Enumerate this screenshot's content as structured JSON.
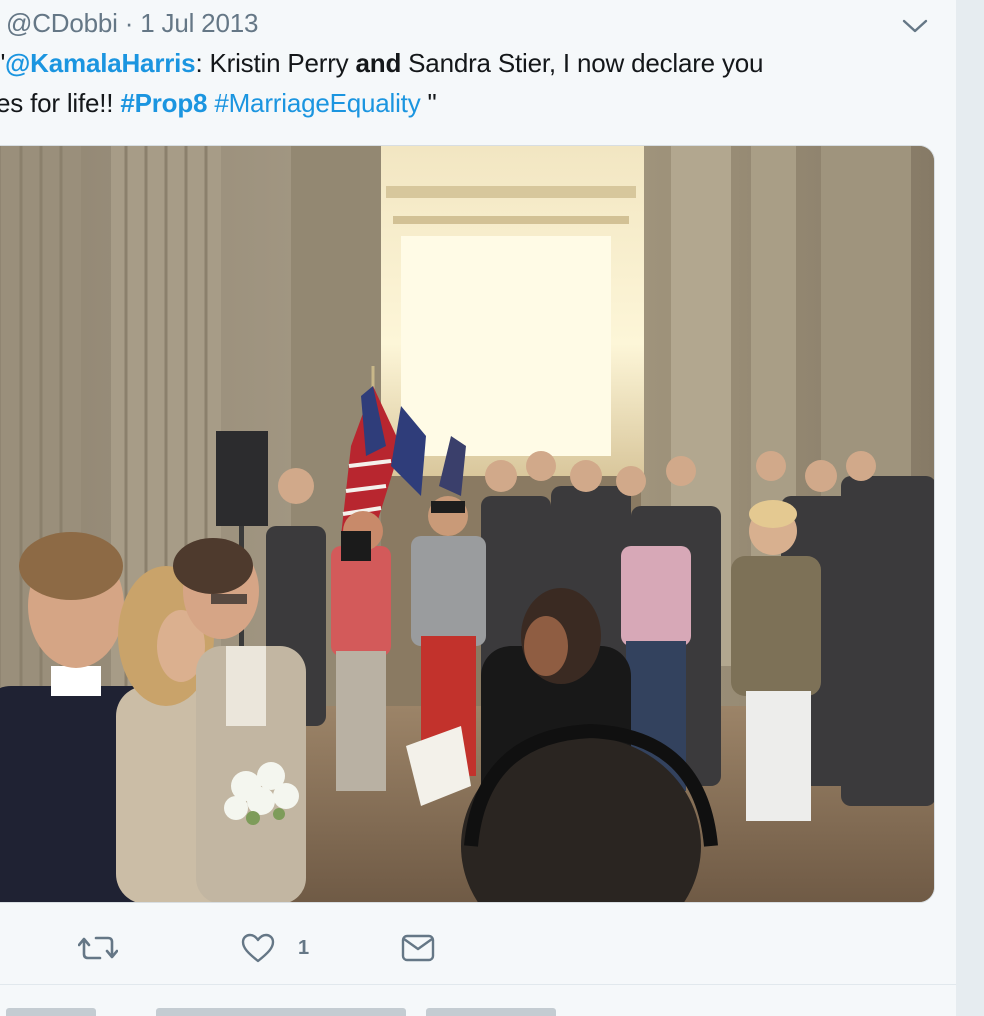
{
  "tweet": {
    "handle": "@CDobbi",
    "separator": "·",
    "date": "1 Jul 2013",
    "text": {
      "quote_open": "\"",
      "mention": "@KamalaHarris",
      "colon": ": Kristin Perry ",
      "and": "and",
      "rest_line1": " Sandra Stier, I now declare you",
      "line2_start": "es for life!! ",
      "hashtag1": "#Prop8",
      "hashtag2": "#MarriageEquality",
      "quote_close": " \""
    },
    "photo": {
      "description_icon": "wedding-ceremony-photo"
    },
    "actions": {
      "retweet_icon": "retweet-icon",
      "like_icon": "heart-icon",
      "like_count": "1",
      "dm_icon": "envelope-icon"
    }
  },
  "colors": {
    "link": "#1b95e0",
    "secondary_text": "#657786",
    "background": "#f5f8fa"
  }
}
